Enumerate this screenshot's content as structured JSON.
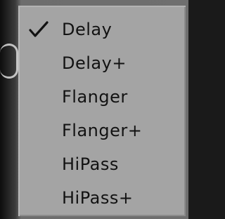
{
  "menu": {
    "items": [
      {
        "label": "Delay",
        "checked": true
      },
      {
        "label": "Delay+",
        "checked": false
      },
      {
        "label": "Flanger",
        "checked": false
      },
      {
        "label": "Flanger+",
        "checked": false
      },
      {
        "label": "HiPass",
        "checked": false
      },
      {
        "label": "HiPass+",
        "checked": false
      }
    ]
  },
  "colors": {
    "menu_background": "#a4a4a4",
    "text": "#121212",
    "backdrop": "#6f6f6f"
  },
  "icons": {
    "selected_marker": "checkmark-icon"
  }
}
